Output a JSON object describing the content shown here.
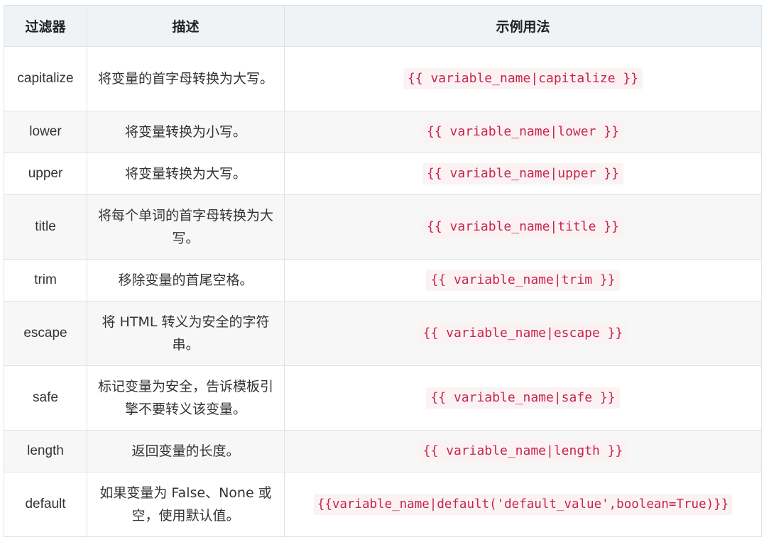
{
  "table": {
    "headers": [
      "过滤器",
      "描述",
      "示例用法"
    ],
    "rows": [
      {
        "filter": "capitalize",
        "description": "将变量的首字母转换为大写。",
        "usage": "{{ variable_name|capitalize }}"
      },
      {
        "filter": "lower",
        "description": "将变量转换为小写。",
        "usage": "{{ variable_name|lower }}"
      },
      {
        "filter": "upper",
        "description": "将变量转换为大写。",
        "usage": "{{ variable_name|upper }}"
      },
      {
        "filter": "title",
        "description": "将每个单词的首字母转换为大写。",
        "usage": "{{ variable_name|title }}"
      },
      {
        "filter": "trim",
        "description": "移除变量的首尾空格。",
        "usage": "{{ variable_name|trim }}"
      },
      {
        "filter": "escape",
        "description": "将 HTML 转义为安全的字符串。",
        "usage": "{{ variable_name|escape }}"
      },
      {
        "filter": "safe",
        "description": "标记变量为安全，告诉模板引擎不要转义该变量。",
        "usage": "{{ variable_name|safe }}"
      },
      {
        "filter": "length",
        "description": "返回变量的长度。",
        "usage": "{{ variable_name|length }}"
      },
      {
        "filter": "default",
        "description": "如果变量为 False、None 或空，使用默认值。",
        "usage": "{{variable_name|default('default_value',boolean=True)}}"
      }
    ]
  },
  "colors": {
    "header_bg": "#f0f3f5",
    "alt_row_bg": "#f7f7f7",
    "border": "#dfe2e5",
    "code_text": "#c7254e",
    "code_bg": "#fbf2f4"
  }
}
